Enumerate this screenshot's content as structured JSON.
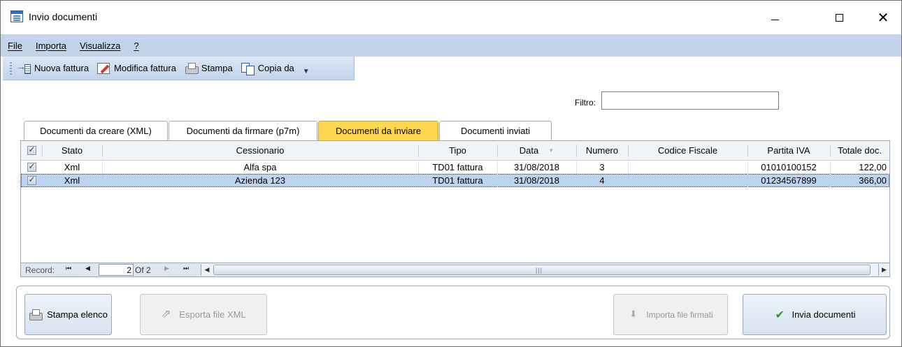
{
  "window": {
    "title": "Invio documenti"
  },
  "menu": {
    "items": [
      "File",
      "Importa",
      "Visualizza",
      "?"
    ]
  },
  "toolbar": {
    "new_invoice": "Nuova fattura",
    "edit_invoice": "Modifica fattura",
    "print": "Stampa",
    "copy_from": "Copia da"
  },
  "filter": {
    "label": "Filtro:",
    "value": ""
  },
  "tabs": [
    {
      "label": "Documenti da creare (XML)",
      "active": false
    },
    {
      "label": "Documenti da firmare (p7m)",
      "active": false
    },
    {
      "label": "Documenti da inviare",
      "active": true
    },
    {
      "label": "Documenti inviati",
      "active": false
    }
  ],
  "grid": {
    "columns": [
      "",
      "Stato",
      "Cessionario",
      "Tipo",
      "Data",
      "Numero",
      "Codice Fiscale",
      "Partita IVA",
      "Totale doc."
    ],
    "rows": [
      {
        "checked": true,
        "stato": "Xml",
        "cessionario": "Alfa spa",
        "tipo": "TD01 fattura",
        "data": "31/08/2018",
        "numero": "3",
        "codice_fiscale": "",
        "partita_iva": "01010100152",
        "totale": "122,00",
        "selected": false
      },
      {
        "checked": true,
        "stato": "Xml",
        "cessionario": "Azienda 123",
        "tipo": "TD01 fattura",
        "data": "31/08/2018",
        "numero": "4",
        "codice_fiscale": "",
        "partita_iva": "01234567899",
        "totale": "366,00",
        "selected": true
      }
    ]
  },
  "navigator": {
    "label": "Record:",
    "current": "2",
    "of_text": "Of 2"
  },
  "actions": {
    "print_list": "Stampa elenco",
    "export_xml": "Esporta file XML",
    "import_signed": "Importa file firmati",
    "send_docs": "Invia documenti"
  },
  "colors": {
    "menu_bg": "#c3d3ea",
    "active_tab": "#ffd64f",
    "selected_row": "#bed3ef"
  }
}
